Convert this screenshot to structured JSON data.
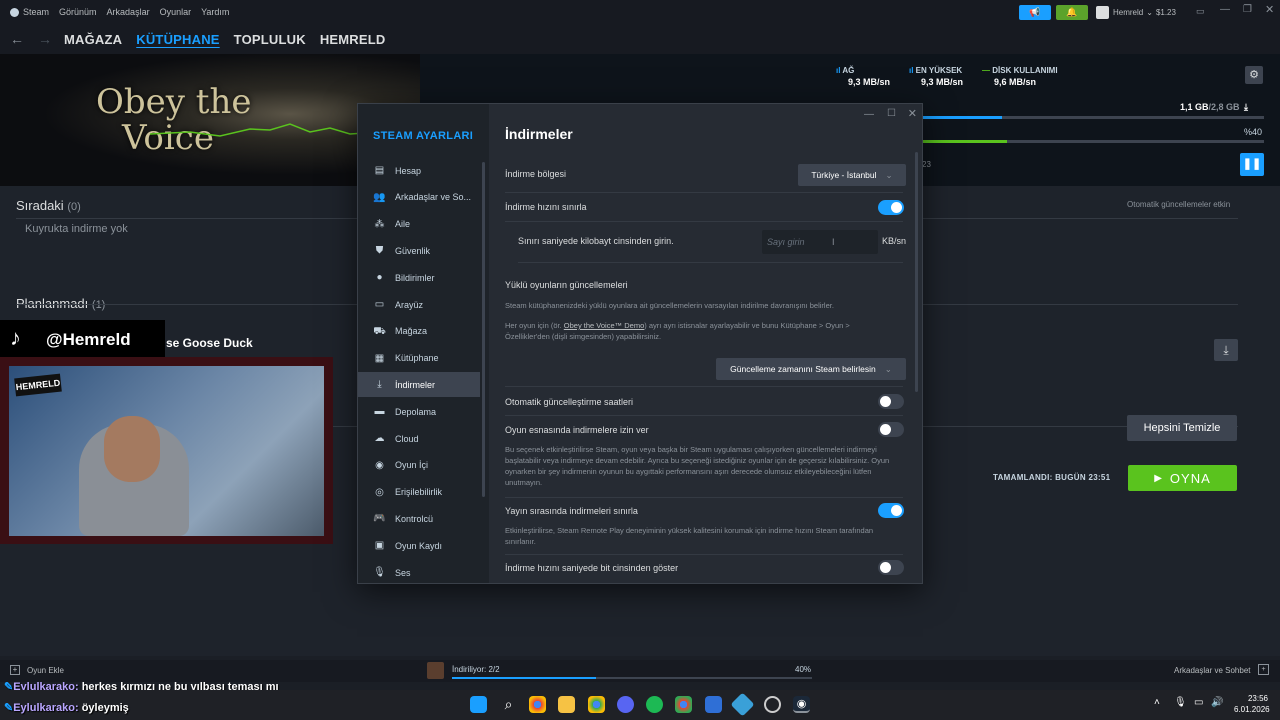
{
  "menu": [
    "Steam",
    "Görünüm",
    "Arkadaşlar",
    "Oyunlar",
    "Yardım"
  ],
  "nav": [
    "MAĞAZA",
    "KÜTÜPHANE",
    "TOPLULUK",
    "HEMRELD"
  ],
  "account": {
    "name": "Hemreld",
    "balance": "$1.23"
  },
  "hero": {
    "logo_line1": "Obey the",
    "logo_line2": "Voice",
    "net_label": "AĞ",
    "net_value": "9,3 MB/sn",
    "peak_label": "EN YÜKSEK",
    "peak_value": "9,3 MB/sn",
    "disk_label": "DİSK KULLANIMI",
    "disk_value": "9,6 MB/sn",
    "size": "1,1 GB",
    "size_total": "/2,8 GB",
    "percent": "%40",
    "time_fragment": "23",
    "auto_updates": "Otomatik güncellemeler etkin"
  },
  "queue": {
    "next_title": "Sıradaki",
    "next_count": "(0)",
    "empty": "Kuyrukta indirme yok",
    "unplanned_title": "Planlanmadı",
    "unplanned_count": "(1)",
    "game": "se Goose Duck",
    "clear_all": "Hepsini Temizle",
    "completed": "TAMAMLANDI: BUGÜN 23:51",
    "play": "OYNA"
  },
  "overlay": {
    "tiktok_handle": "@Hemreld"
  },
  "settings": {
    "title": "STEAM AYARLARI",
    "sidebar": [
      {
        "label": "Hesap",
        "icon": "account-icon",
        "glyph": "▤"
      },
      {
        "label": "Arkadaşlar ve So...",
        "icon": "friends-icon",
        "glyph": "👥"
      },
      {
        "label": "Aile",
        "icon": "family-icon",
        "glyph": "⁂"
      },
      {
        "label": "Güvenlik",
        "icon": "shield-icon",
        "glyph": "⛊"
      },
      {
        "label": "Bildirimler",
        "icon": "notification-icon",
        "glyph": "●"
      },
      {
        "label": "Arayüz",
        "icon": "monitor-icon",
        "glyph": "▭"
      },
      {
        "label": "Mağaza",
        "icon": "cart-icon",
        "glyph": "⛟"
      },
      {
        "label": "Kütüphane",
        "icon": "grid-icon",
        "glyph": "▦"
      },
      {
        "label": "İndirmeler",
        "icon": "download-icon",
        "glyph": "⤓"
      },
      {
        "label": "Depolama",
        "icon": "storage-icon",
        "glyph": "▬"
      },
      {
        "label": "Cloud",
        "icon": "cloud-icon",
        "glyph": "☁"
      },
      {
        "label": "Oyun İçi",
        "icon": "ingame-icon",
        "glyph": "◉"
      },
      {
        "label": "Erişilebilirlik",
        "icon": "accessibility-icon",
        "glyph": "◎"
      },
      {
        "label": "Kontrolcü",
        "icon": "controller-icon",
        "glyph": "🎮"
      },
      {
        "label": "Oyun Kaydı",
        "icon": "recording-icon",
        "glyph": "▣"
      },
      {
        "label": "Ses",
        "icon": "microphone-icon",
        "glyph": "🎙"
      }
    ],
    "selected_index": 8,
    "page_title": "İndirmeler",
    "region_label": "İndirme bölgesi",
    "region_value": "Türkiye - İstanbul",
    "limit_label": "İndirme hızını sınırla",
    "limit_on": true,
    "limit_input_label": "Sınırı saniyede kilobayt cinsinden girin.",
    "limit_placeholder": "Sayı girin",
    "limit_unit": "KB/sn",
    "updates_title": "Yüklü oyunların güncellemeleri",
    "updates_desc1": "Steam kütüphanenizdeki yüklü oyunlara ait güncellemelerin varsayılan indirilme davranışını belirler.",
    "updates_desc2a": "Her oyun için (ör. ",
    "updates_desc2_link": "Obey the Voice™ Demo",
    "updates_desc2b": ") ayrı ayrı istisnalar ayarlayabilir ve bunu Kütüphane > Oyun > Özellikler'den (dişli simgesinden) yapabilirsiniz.",
    "updates_dropdown": "Güncelleme zamanını Steam belirlesin",
    "auto_hours_label": "Otomatik güncelleştirme saatleri",
    "auto_hours_on": false,
    "allow_ingame_label": "Oyun esnasında indirmelere izin ver",
    "allow_ingame_on": false,
    "allow_ingame_desc": "Bu seçenek etkinleştirilirse Steam, oyun veya başka bir Steam uygulaması çalışıyorken güncellemeleri indirmeyi başlatabilir veya indirmeye devam edebilir. Ayrıca bu seçeneği istediğiniz oyunlar için de geçersiz kılabilirsiniz. Oyun oynarken bir şey indirmenin oyunun bu aygıttaki performansını aşırı derecede olumsuz etkileyebileceğini lütfen unutmayın.",
    "stream_label": "Yayın sırasında indirmeleri sınırla",
    "stream_on": true,
    "stream_desc": "Etkinleştirilirse, Steam Remote Play deneyiminin yüksek kalitesini korumak için indirme hızını Steam tarafından sınırlanır.",
    "bits_label": "İndirme hızını saniyede bit cinsinden göster",
    "bits_on": false
  },
  "bottom": {
    "add_game": "Oyun Ekle",
    "downloading": "İndiriliyor: 2/2",
    "progress": 0.4,
    "progress_text": "40%",
    "friends": "Arkadaşlar ve Sohbet"
  },
  "chat": [
    {
      "user": "Eylulkarako:",
      "msg": " herkes kırmızı ne bu yılbaşı teması mı"
    },
    {
      "user": "Eylulkarako:",
      "msg": " öyleymiş"
    }
  ],
  "clock": {
    "time": "23:56",
    "date": "6.01.2026"
  },
  "colors": {
    "accent": "#1a9fff",
    "play": "#5ac31e"
  }
}
